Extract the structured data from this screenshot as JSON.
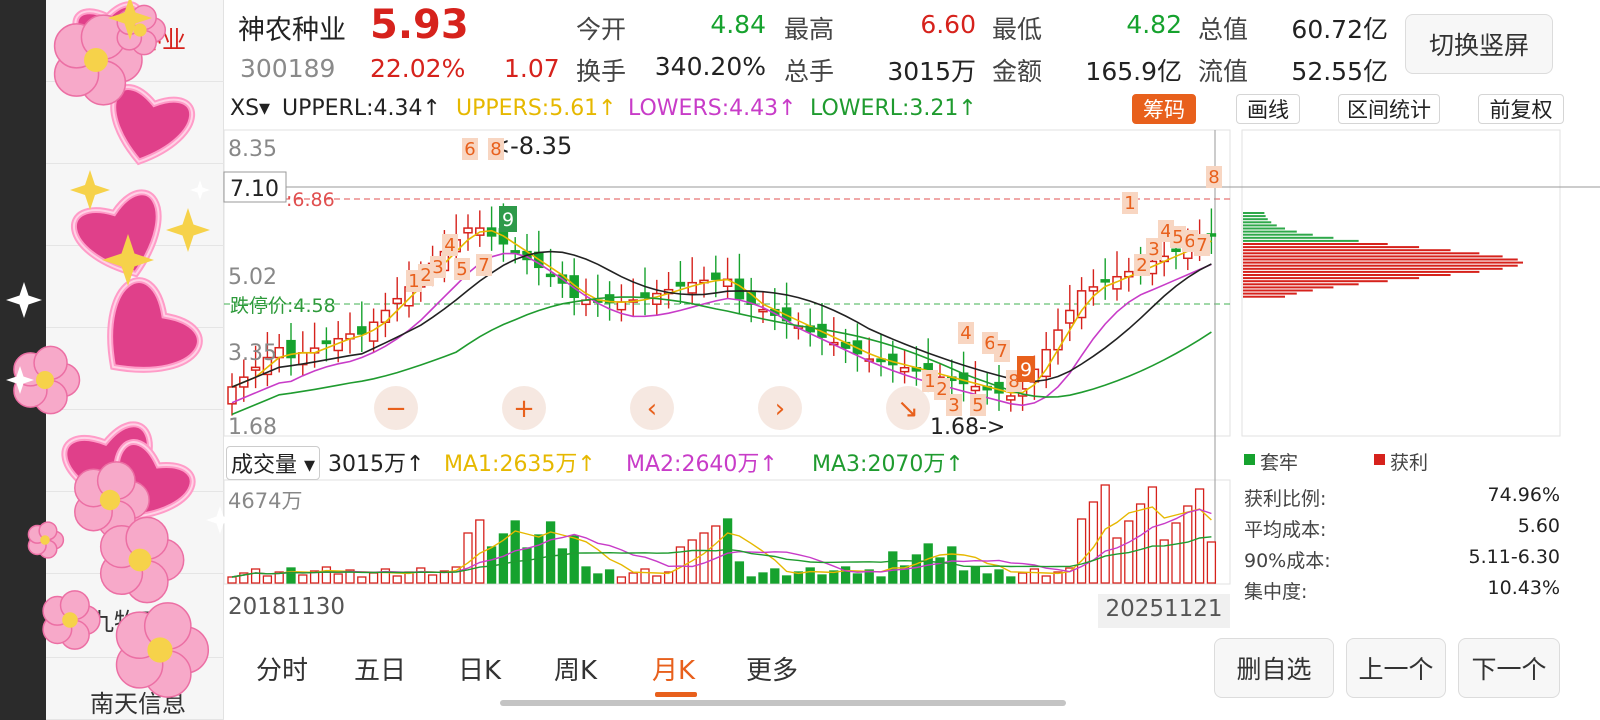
{
  "sidebar": {
    "items": [
      {
        "label": "神农种业"
      },
      {
        "label": "九牧王"
      },
      {
        "label": "南天信息"
      }
    ]
  },
  "header": {
    "name": "神农种业",
    "price": "5.93",
    "code": "300189",
    "change_pct": "22.02%",
    "change": "1.07",
    "fields": [
      {
        "label": "今开",
        "value": "4.84",
        "color": "green"
      },
      {
        "label": "最高",
        "value": "6.60",
        "color": "red"
      },
      {
        "label": "最低",
        "value": "4.82",
        "color": "green"
      },
      {
        "label": "总值",
        "value": "60.72亿",
        "color": "dark"
      },
      {
        "label": "换手",
        "value": "340.20%",
        "color": "dark"
      },
      {
        "label": "总手",
        "value": "3015万",
        "color": "dark"
      },
      {
        "label": "金额",
        "value": "165.9亿",
        "color": "dark"
      },
      {
        "label": "流值",
        "value": "52.55亿",
        "color": "dark"
      }
    ],
    "switch_label": "切换竖屏"
  },
  "indicator": {
    "selector": "XS▾",
    "upperl": "UPPERL:4.34↑",
    "uppers": "UPPERS:5.61↑",
    "lowers": "LOWERS:4.43↑",
    "lowerl": "LOWERL:3.21↑",
    "chips": [
      "筹码",
      "画线",
      "区间统计",
      "前复权"
    ]
  },
  "kline": {
    "y_labels": [
      "8.35",
      "7.10",
      "6.86",
      "5.02",
      "3.35",
      "1.68"
    ],
    "ref_labels": {
      "high": "<-8.35",
      "low": "1.68->",
      "up_limit": ":6.86",
      "down_limit": "跌停价:4.58"
    },
    "td_numbers": [
      "1",
      "2",
      "3",
      "4",
      "5",
      "6",
      "7",
      "8",
      "9"
    ]
  },
  "volume": {
    "selector": "成交量",
    "value": "3015万↑",
    "ma1": "MA1:2635万↑",
    "ma2": "MA2:2640万↑",
    "ma3": "MA3:2070万↑",
    "y_label": "4674万",
    "start_date": "20181130",
    "end_date": "20251121"
  },
  "chips_panel": {
    "legend": [
      {
        "label": "套牢",
        "color": "#16a22e"
      },
      {
        "label": "获利",
        "color": "#d6221c"
      }
    ],
    "stats": [
      {
        "label": "获利比例:",
        "value": "74.96%"
      },
      {
        "label": "平均成本:",
        "value": "5.60"
      },
      {
        "label": "90%成本:",
        "value": "5.11-6.30"
      },
      {
        "label": "集中度:",
        "value": "10.43%"
      }
    ]
  },
  "tabs": [
    {
      "label": "分时"
    },
    {
      "label": "五日"
    },
    {
      "label": "日K"
    },
    {
      "label": "周K"
    },
    {
      "label": "月K",
      "active": true
    },
    {
      "label": "更多"
    }
  ],
  "buttons": {
    "delete": "删自选",
    "prev": "上一个",
    "next": "下一个"
  },
  "colors": {
    "up": "#d6221c",
    "down": "#16a22e",
    "accent": "#e8601c",
    "ma_yellow": "#e6b800",
    "ma_magenta": "#c83cc8",
    "ma_green": "#1f9b2f"
  }
}
